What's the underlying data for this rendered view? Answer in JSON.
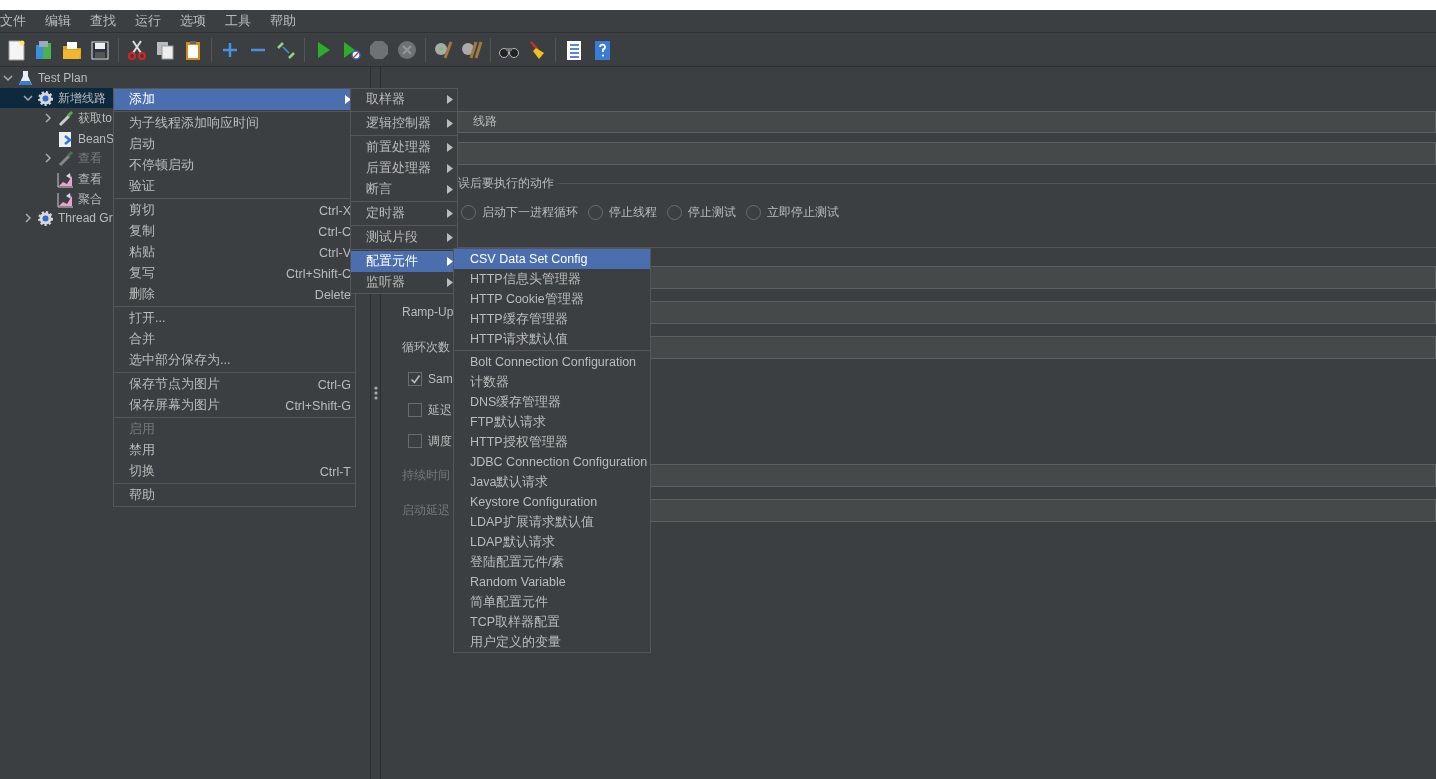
{
  "menubar": [
    {
      "label": "文件"
    },
    {
      "label": "编辑"
    },
    {
      "label": "查找"
    },
    {
      "label": "运行"
    },
    {
      "label": "选项"
    },
    {
      "label": "工具"
    },
    {
      "label": "帮助"
    }
  ],
  "toolbar": [
    {
      "kind": "new",
      "disabled": false
    },
    {
      "kind": "templates",
      "disabled": false
    },
    {
      "kind": "open",
      "disabled": false
    },
    {
      "kind": "save",
      "disabled": false
    },
    {
      "kind": "separator"
    },
    {
      "kind": "cut",
      "disabled": false
    },
    {
      "kind": "copy",
      "disabled": false
    },
    {
      "kind": "paste",
      "disabled": false
    },
    {
      "kind": "separator"
    },
    {
      "kind": "expand",
      "disabled": false
    },
    {
      "kind": "collapse",
      "disabled": false
    },
    {
      "kind": "toggle",
      "disabled": false
    },
    {
      "kind": "separator"
    },
    {
      "kind": "start",
      "disabled": false
    },
    {
      "kind": "start_no_pause",
      "disabled": false
    },
    {
      "kind": "stop",
      "disabled": true
    },
    {
      "kind": "shutdown",
      "disabled": true
    },
    {
      "kind": "separator"
    },
    {
      "kind": "clear",
      "disabled": false
    },
    {
      "kind": "clear_all",
      "disabled": false
    },
    {
      "kind": "separator"
    },
    {
      "kind": "search",
      "disabled": false
    },
    {
      "kind": "reset",
      "disabled": false
    },
    {
      "kind": "separator"
    },
    {
      "kind": "functions",
      "disabled": false
    },
    {
      "kind": "help",
      "disabled": false
    }
  ],
  "tree": [
    {
      "label": "Test Plan",
      "kind": "plan",
      "expanded": true,
      "selected": false,
      "disabled": false,
      "children": [
        {
          "label": "新增线路",
          "kind": "group",
          "expanded": true,
          "selected": true,
          "disabled": false,
          "children": [
            {
              "label": "获取to",
              "kind": "sampler",
              "expanded": false,
              "selected": false,
              "disabled": false
            },
            {
              "label": "BeanS",
              "kind": "script",
              "selected": false,
              "disabled": false
            },
            {
              "label": "查看",
              "kind": "sampler",
              "expanded": false,
              "selected": false,
              "disabled": true
            },
            {
              "label": "查看",
              "kind": "listener",
              "selected": false,
              "disabled": false
            },
            {
              "label": "聚合",
              "kind": "listener",
              "selected": false,
              "disabled": false
            }
          ]
        },
        {
          "label": "Thread Gr",
          "kind": "group",
          "expanded": false,
          "selected": false,
          "disabled": false
        }
      ]
    }
  ],
  "panel": {
    "name_value": "线路",
    "error_group_title": "误后要执行的动作",
    "radios": [
      {
        "label": "启动下一进程循环",
        "selected": false
      },
      {
        "label": "停止线程",
        "selected": false
      },
      {
        "label": "停止测试",
        "selected": false
      },
      {
        "label": "立即停止测试",
        "selected": false
      }
    ],
    "properties": [
      {
        "kind": "field"
      },
      {
        "kind": "field",
        "label": "Ramp-Up",
        "disabled": false
      },
      {
        "kind": "field",
        "label": "循环次数",
        "disabled": false
      },
      {
        "kind": "checkbox",
        "label": "Sam",
        "checked": true
      },
      {
        "kind": "checkbox",
        "label": "延迟",
        "checked": false
      },
      {
        "kind": "checkbox",
        "label": "调度",
        "checked": false
      },
      {
        "kind": "field",
        "label": "持续时间",
        "disabled": true
      },
      {
        "kind": "field",
        "label": "启动延迟",
        "disabled": true
      }
    ]
  },
  "context_menu": [
    {
      "kind": "item",
      "label": "添加",
      "submenu": true,
      "selected": true,
      "disabled": false
    },
    {
      "kind": "separator"
    },
    {
      "kind": "item",
      "label": "为子线程添加响应时间",
      "selected": false,
      "disabled": false
    },
    {
      "kind": "item",
      "label": "启动",
      "selected": false,
      "disabled": false
    },
    {
      "kind": "item",
      "label": "不停顿启动",
      "selected": false,
      "disabled": false
    },
    {
      "kind": "item",
      "label": "验证",
      "selected": false,
      "disabled": false
    },
    {
      "kind": "separator"
    },
    {
      "kind": "item",
      "label": "剪切",
      "shortcut": "Ctrl-X",
      "selected": false,
      "disabled": false
    },
    {
      "kind": "item",
      "label": "复制",
      "shortcut": "Ctrl-C",
      "selected": false,
      "disabled": false
    },
    {
      "kind": "item",
      "label": "粘贴",
      "shortcut": "Ctrl-V",
      "selected": false,
      "disabled": false
    },
    {
      "kind": "item",
      "label": "复写",
      "shortcut": "Ctrl+Shift-C",
      "selected": false,
      "disabled": false
    },
    {
      "kind": "item",
      "label": "删除",
      "shortcut": "Delete",
      "selected": false,
      "disabled": false
    },
    {
      "kind": "separator"
    },
    {
      "kind": "item",
      "label": "打开...",
      "selected": false,
      "disabled": false
    },
    {
      "kind": "item",
      "label": "合并",
      "selected": false,
      "disabled": false
    },
    {
      "kind": "item",
      "label": "选中部分保存为...",
      "selected": false,
      "disabled": false
    },
    {
      "kind": "separator"
    },
    {
      "kind": "item",
      "label": "保存节点为图片",
      "shortcut": "Ctrl-G",
      "selected": false,
      "disabled": false
    },
    {
      "kind": "item",
      "label": "保存屏幕为图片",
      "shortcut": "Ctrl+Shift-G",
      "selected": false,
      "disabled": false
    },
    {
      "kind": "separator"
    },
    {
      "kind": "item",
      "label": "启用",
      "selected": false,
      "disabled": true
    },
    {
      "kind": "item",
      "label": "禁用",
      "selected": false,
      "disabled": false
    },
    {
      "kind": "item",
      "label": "切换",
      "shortcut": "Ctrl-T",
      "selected": false,
      "disabled": false
    },
    {
      "kind": "separator"
    },
    {
      "kind": "item",
      "label": "帮助",
      "selected": false,
      "disabled": false
    }
  ],
  "add_submenu": [
    {
      "kind": "item",
      "label": "取样器",
      "submenu": true,
      "selected": false
    },
    {
      "kind": "separator"
    },
    {
      "kind": "item",
      "label": "逻辑控制器",
      "submenu": true,
      "selected": false
    },
    {
      "kind": "separator"
    },
    {
      "kind": "item",
      "label": "前置处理器",
      "submenu": true,
      "selected": false
    },
    {
      "kind": "item",
      "label": "后置处理器",
      "submenu": true,
      "selected": false
    },
    {
      "kind": "item",
      "label": "断言",
      "submenu": true,
      "selected": false
    },
    {
      "kind": "separator"
    },
    {
      "kind": "item",
      "label": "定时器",
      "submenu": true,
      "selected": false
    },
    {
      "kind": "separator"
    },
    {
      "kind": "item",
      "label": "测试片段",
      "submenu": true,
      "selected": false
    },
    {
      "kind": "separator"
    },
    {
      "kind": "item",
      "label": "配置元件",
      "submenu": true,
      "selected": true
    },
    {
      "kind": "item",
      "label": "监听器",
      "submenu": true,
      "selected": false
    }
  ],
  "config_submenu": [
    {
      "kind": "item",
      "label": "CSV Data Set Config",
      "selected": true
    },
    {
      "kind": "item",
      "label": "HTTP信息头管理器",
      "selected": false
    },
    {
      "kind": "item",
      "label": "HTTP Cookie管理器",
      "selected": false
    },
    {
      "kind": "item",
      "label": "HTTP缓存管理器",
      "selected": false
    },
    {
      "kind": "item",
      "label": "HTTP请求默认值",
      "selected": false
    },
    {
      "kind": "separator"
    },
    {
      "kind": "item",
      "label": "Bolt Connection Configuration",
      "selected": false
    },
    {
      "kind": "item",
      "label": "计数器",
      "selected": false
    },
    {
      "kind": "item",
      "label": "DNS缓存管理器",
      "selected": false
    },
    {
      "kind": "item",
      "label": "FTP默认请求",
      "selected": false
    },
    {
      "kind": "item",
      "label": "HTTP授权管理器",
      "selected": false
    },
    {
      "kind": "item",
      "label": "JDBC Connection Configuration",
      "selected": false
    },
    {
      "kind": "item",
      "label": "Java默认请求",
      "selected": false
    },
    {
      "kind": "item",
      "label": "Keystore Configuration",
      "selected": false
    },
    {
      "kind": "item",
      "label": "LDAP扩展请求默认值",
      "selected": false
    },
    {
      "kind": "item",
      "label": "LDAP默认请求",
      "selected": false
    },
    {
      "kind": "item",
      "label": "登陆配置元件/素",
      "selected": false
    },
    {
      "kind": "item",
      "label": "Random Variable",
      "selected": false
    },
    {
      "kind": "item",
      "label": "简单配置元件",
      "selected": false
    },
    {
      "kind": "item",
      "label": "TCP取样器配置",
      "selected": false
    },
    {
      "kind": "item",
      "label": "用户定义的变量",
      "selected": false
    }
  ]
}
